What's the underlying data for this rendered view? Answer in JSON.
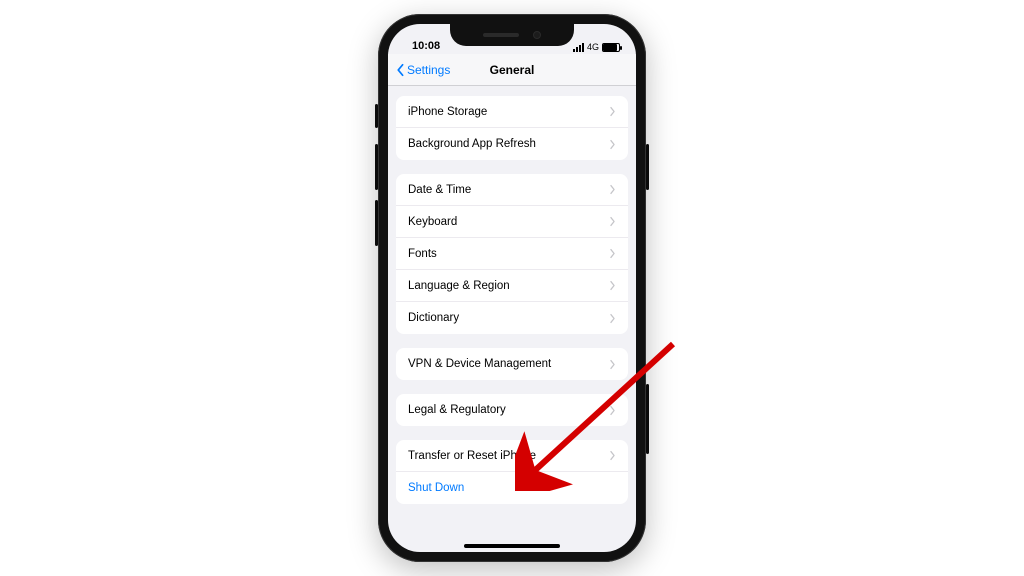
{
  "statusbar": {
    "time": "10:08",
    "network": "4G"
  },
  "navbar": {
    "back": "Settings",
    "title": "General"
  },
  "groups": {
    "g0": {
      "iphone_storage": "iPhone Storage",
      "bg_refresh": "Background App Refresh"
    },
    "g1": {
      "date_time": "Date & Time",
      "keyboard": "Keyboard",
      "fonts": "Fonts",
      "lang_region": "Language & Region",
      "dictionary": "Dictionary"
    },
    "g2": {
      "vpn": "VPN & Device Management"
    },
    "g3": {
      "legal": "Legal & Regulatory"
    },
    "g4": {
      "reset": "Transfer or Reset iPhone",
      "shutdown": "Shut Down"
    }
  },
  "colors": {
    "tint": "#007aff",
    "screen_bg": "#f2f2f6"
  }
}
